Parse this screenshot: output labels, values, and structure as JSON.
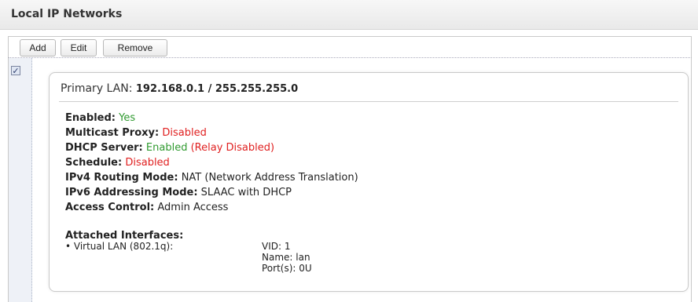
{
  "header": {
    "title": "Local IP Networks"
  },
  "toolbar": {
    "add_label": "Add",
    "edit_label": "Edit",
    "remove_label": "Remove"
  },
  "list": {
    "checkbox_checked": true,
    "checkbox_glyph": "✓"
  },
  "card": {
    "title_label": "Primary LAN:",
    "title_value": "192.168.0.1 / 255.255.255.0",
    "rows": [
      {
        "label": "Enabled:",
        "value": "Yes"
      },
      {
        "label": "Multicast Proxy:",
        "value": "Disabled"
      },
      {
        "label": "DHCP Server:",
        "value": "Enabled",
        "extra": "(Relay Disabled)"
      },
      {
        "label": "Schedule:",
        "value": "Disabled"
      },
      {
        "label": "IPv4 Routing Mode:",
        "value": "NAT (Network Address Translation)"
      },
      {
        "label": "IPv6 Addressing Mode:",
        "value": "SLAAC with DHCP"
      },
      {
        "label": "Access Control:",
        "value": "Admin Access"
      }
    ],
    "attached": {
      "label": "Attached Interfaces:",
      "iface_name": "• Virtual LAN (802.1q):",
      "vid": "VID: 1",
      "name": "Name: lan",
      "ports": "Port(s): 0U"
    }
  },
  "colors": {
    "enabled_green": "#2f9a2f",
    "disabled_red": "#e02020"
  }
}
